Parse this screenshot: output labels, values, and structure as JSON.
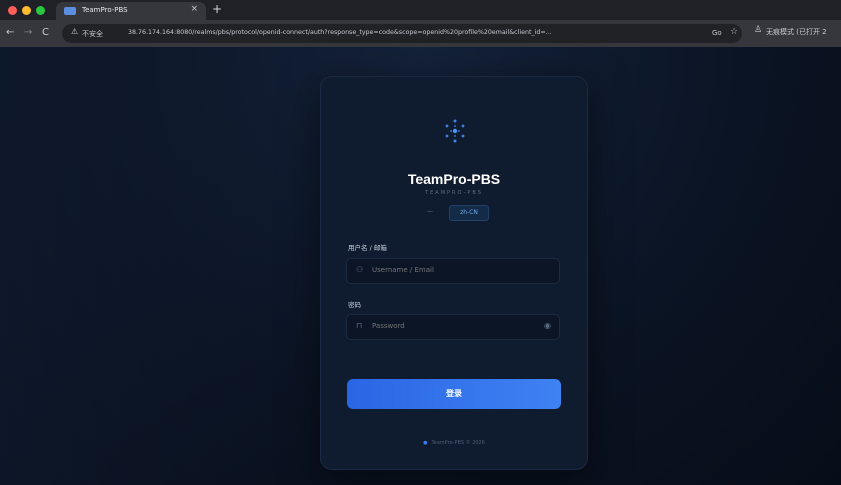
{
  "browser": {
    "tab_title": "TeamPro-PBS",
    "tab_close": "×",
    "new_tab": "+",
    "nav_back": "←",
    "nav_forward": "→",
    "nav_reload": "C",
    "security_label": "不安全",
    "url": "38.76.174.164:8080/realms/pbs/protocol/openid-connect/auth?response_type=code&scope=openid%20profile%20email&client_id=...",
    "url_extra": "Go",
    "profile_label": "无痕模式 (已打开 2",
    "icons": {
      "security": "warning-triangle-icon",
      "star": "star-icon",
      "profile": "incognito-icon"
    }
  },
  "login": {
    "brand_title": "TeamPro-PBS",
    "brand_subtitle": "TEAMPRO-PBS",
    "lang_separator": "—",
    "lang_code": "zh-CN",
    "username_label": "用户名 / 邮箱",
    "username_placeholder": "Username / Email",
    "password_label": "密码",
    "password_placeholder": "Password",
    "submit_label": "登录",
    "footer_text": "TeamPro-PBS © 2026"
  },
  "colors": {
    "accent": "#3b7be6",
    "card_bg": "#0f1b2e",
    "page_bg": "#0b1220"
  }
}
